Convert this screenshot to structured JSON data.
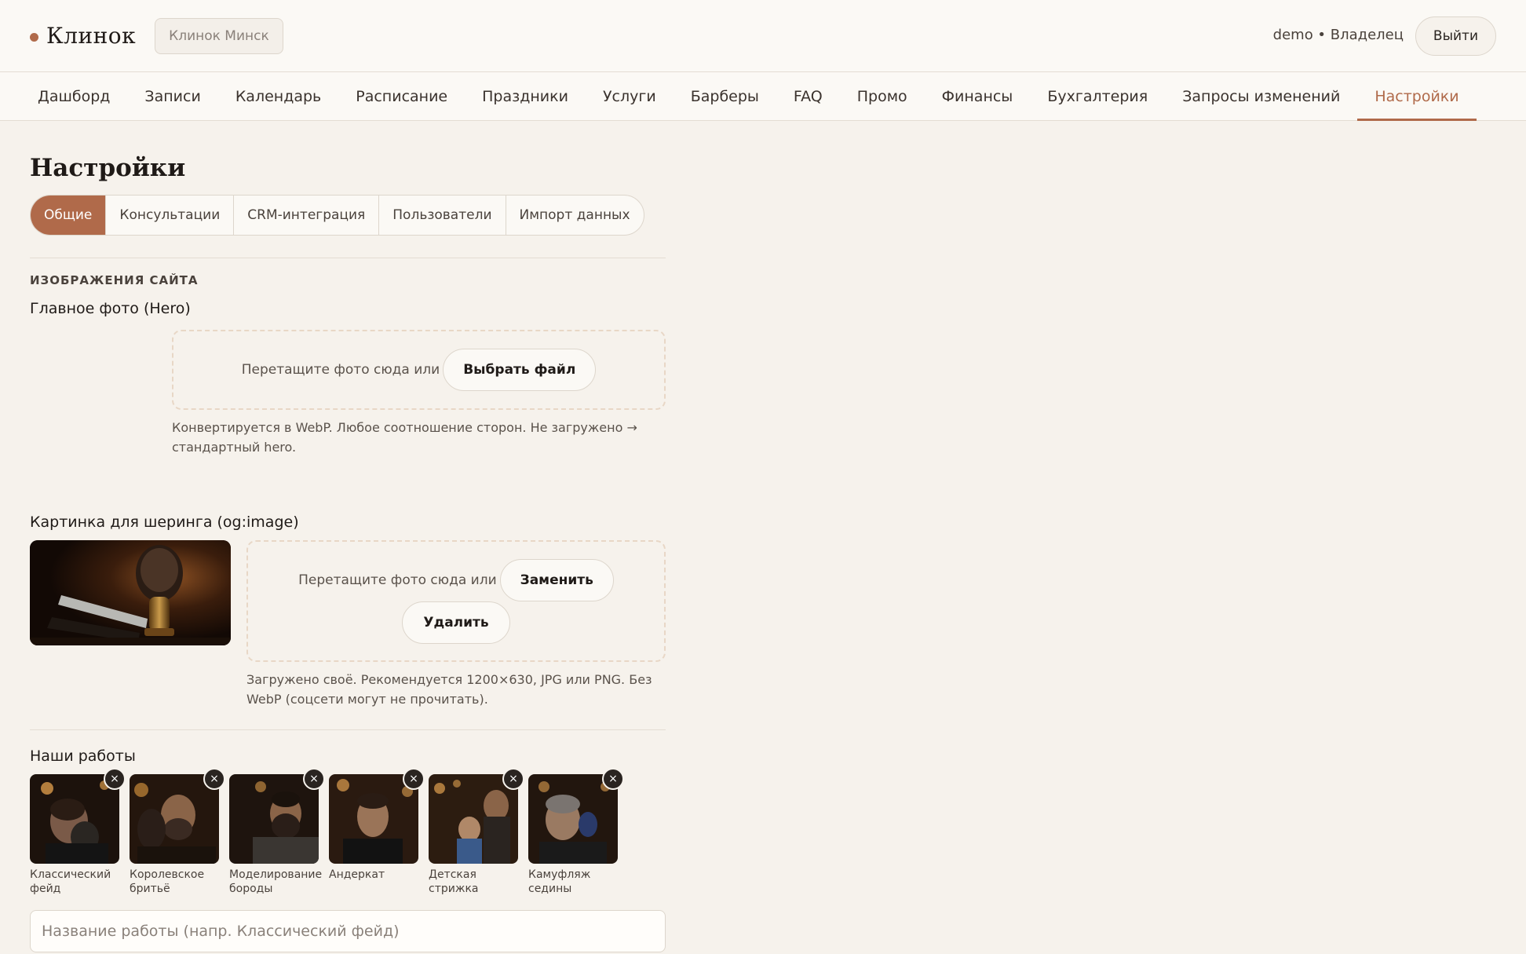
{
  "header": {
    "brand": "Клинок",
    "studio": "Клинок Минск",
    "user": "demo • Владелец",
    "logout": "Выйти"
  },
  "nav": {
    "items": [
      "Дашборд",
      "Записи",
      "Календарь",
      "Расписание",
      "Праздники",
      "Услуги",
      "Барберы",
      "FAQ",
      "Промо",
      "Финансы",
      "Бухгалтерия",
      "Запросы изменений",
      "Настройки"
    ],
    "active": "Настройки"
  },
  "page": {
    "title": "Настройки",
    "tabs": [
      "Общие",
      "Консультации",
      "CRM-интеграция",
      "Пользователи",
      "Импорт данных"
    ],
    "active_tab": "Общие"
  },
  "images_section": {
    "label": "ИЗОБРАЖЕНИЯ САЙТА",
    "hero": {
      "title": "Главное фото (Hero)",
      "drop_text": "Перетащите фото сюда или",
      "choose_button": "Выбрать файл",
      "hint": "Конвертируется в WebP. Любое соотношение сторон. Не загружено → стандартный hero."
    },
    "og": {
      "title": "Картинка для шеринга (og:image)",
      "drop_text": "Перетащите фото сюда или",
      "replace_button": "Заменить",
      "delete_button": "Удалить",
      "hint": "Загружено своё. Рекомендуется 1200×630, JPG или PNG. Без WebP (соцсети могут не прочитать)."
    }
  },
  "works": {
    "title": "Наши работы",
    "items": [
      {
        "caption": "Классический фейд"
      },
      {
        "caption": "Королевское бритьё"
      },
      {
        "caption": "Моделирование бороды"
      },
      {
        "caption": "Андеркат"
      },
      {
        "caption": "Детская стрижка"
      },
      {
        "caption": "Камуфляж седины"
      }
    ],
    "remove_icon": "×",
    "input_placeholder": "Название работы (напр. Классический фейд)"
  },
  "colors": {
    "accent": "#b06a4a",
    "background": "#f6f2ec"
  }
}
